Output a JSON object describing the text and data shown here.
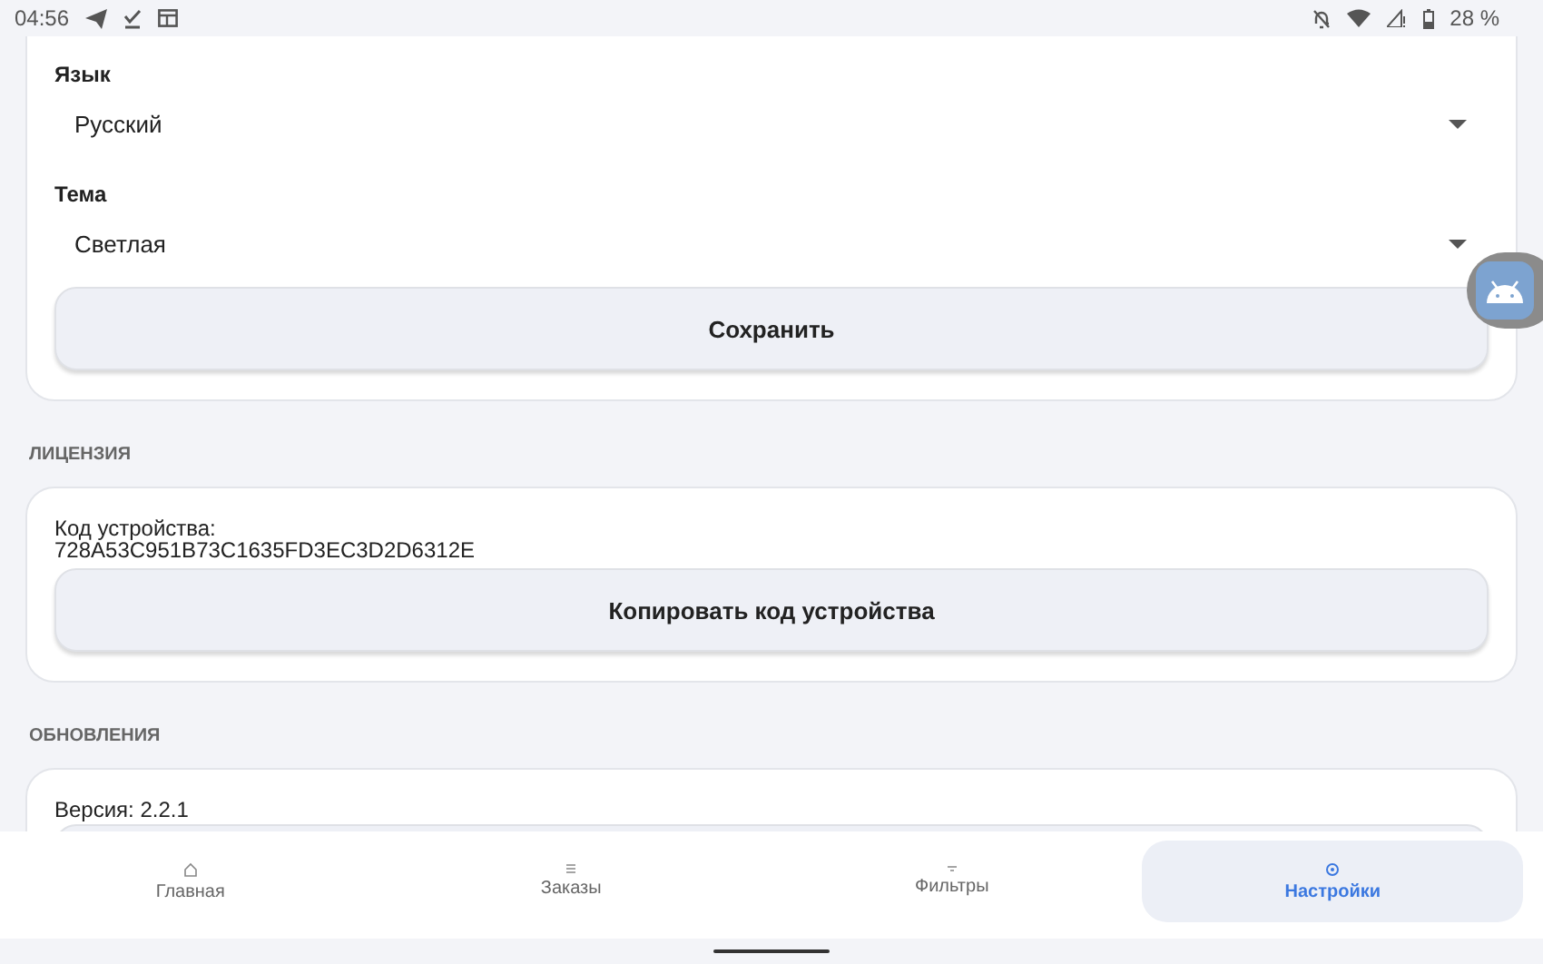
{
  "status_bar": {
    "time": "04:56",
    "battery": "28 %"
  },
  "appearance": {
    "fields": [
      {
        "label": "Язык",
        "value": "Русский"
      },
      {
        "label": "Тема",
        "value": "Светлая"
      }
    ],
    "save_button": "Сохранить"
  },
  "license": {
    "heading": "ЛИЦЕНЗИЯ",
    "code_label": "Код устройства:",
    "code": "728A53C951B73C1635FD3EC3D2D6312E",
    "copy_button": "Копировать код устройства"
  },
  "updates": {
    "heading": "ОБНОВЛЕНИЯ",
    "version": "Версия: 2.2.1"
  },
  "nav": [
    {
      "label": "Главная",
      "kind": "home",
      "selected": false
    },
    {
      "label": "Заказы",
      "kind": "list",
      "selected": false
    },
    {
      "label": "Фильтры",
      "kind": "filter",
      "selected": false
    },
    {
      "label": "Настройки",
      "kind": "settings",
      "selected": true
    }
  ]
}
